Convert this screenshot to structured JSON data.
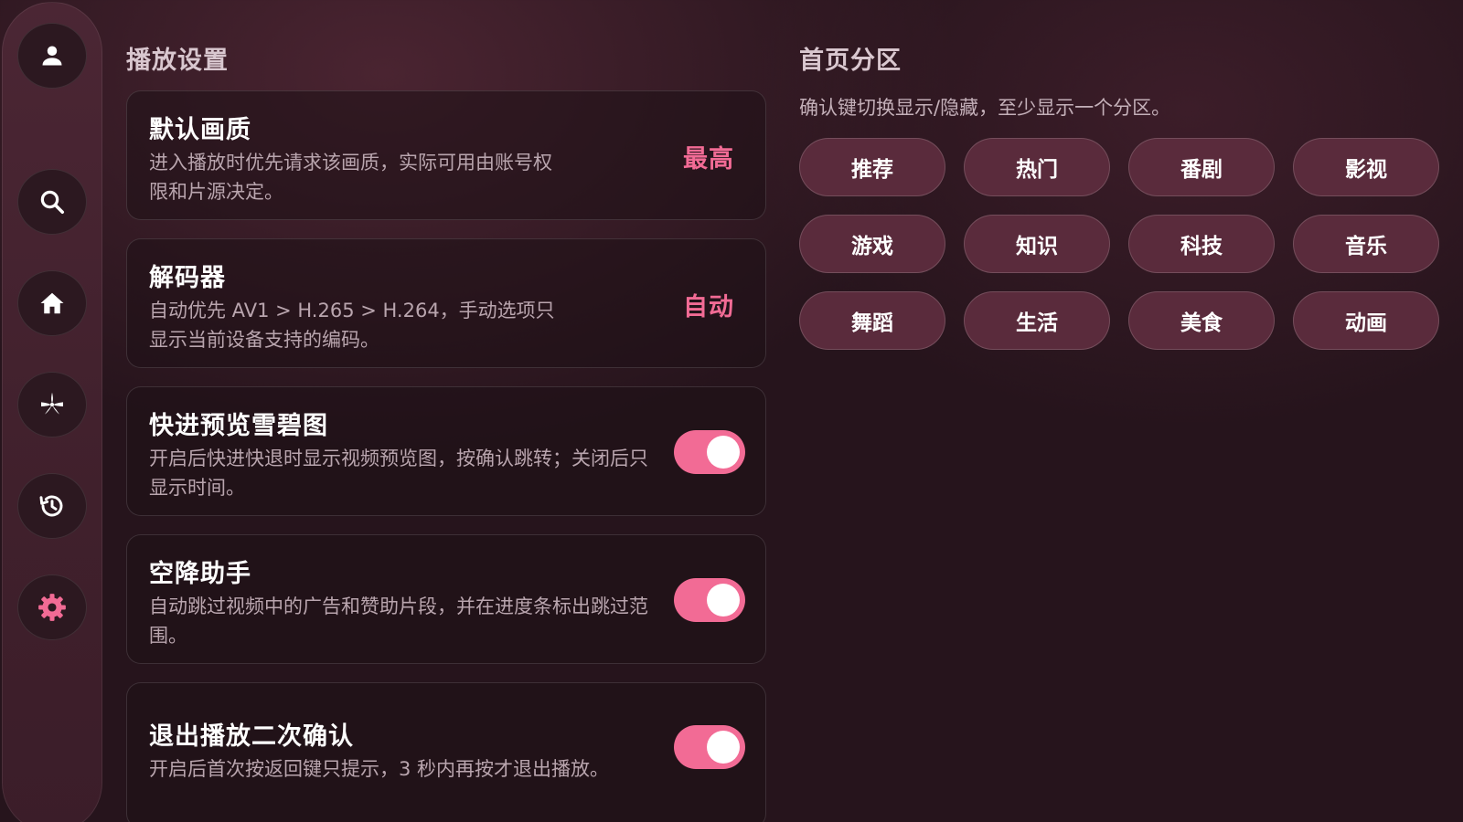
{
  "sidebar": {
    "items": [
      {
        "icon": "user-icon"
      },
      {
        "icon": "search-icon"
      },
      {
        "icon": "home-icon"
      },
      {
        "icon": "sparkle-icon"
      },
      {
        "icon": "history-icon"
      },
      {
        "icon": "gear-icon",
        "active": true
      }
    ]
  },
  "playback": {
    "title": "播放设置",
    "settings": [
      {
        "title": "默认画质",
        "desc": "进入播放时优先请求该画质，实际可用由账号权限和片源决定。",
        "value": "最高"
      },
      {
        "title": "解码器",
        "desc": "自动优先 AV1 > H.265 > H.264，手动选项只显示当前设备支持的编码。",
        "value": "自动"
      },
      {
        "title": "快进预览雪碧图",
        "desc": "开启后快进快退时显示视频预览图，按确认跳转；关闭后只显示时间。",
        "enabled": true
      },
      {
        "title": "空降助手",
        "desc": "自动跳过视频中的广告和赞助片段，并在进度条标出跳过范围。",
        "enabled": true
      },
      {
        "title": "退出播放二次确认",
        "desc": "开启后首次按返回键只提示，3 秒内再按才退出播放。",
        "enabled": true
      }
    ]
  },
  "zones": {
    "title": "首页分区",
    "hint": "确认键切换显示/隐藏，至少显示一个分区。",
    "chips": [
      "推荐",
      "热门",
      "番剧",
      "影视",
      "游戏",
      "知识",
      "科技",
      "音乐",
      "舞蹈",
      "生活",
      "美食",
      "动画"
    ]
  },
  "colors": {
    "accent": "#f26b95",
    "background": "#26141c",
    "chip": "#5a2b3c"
  }
}
